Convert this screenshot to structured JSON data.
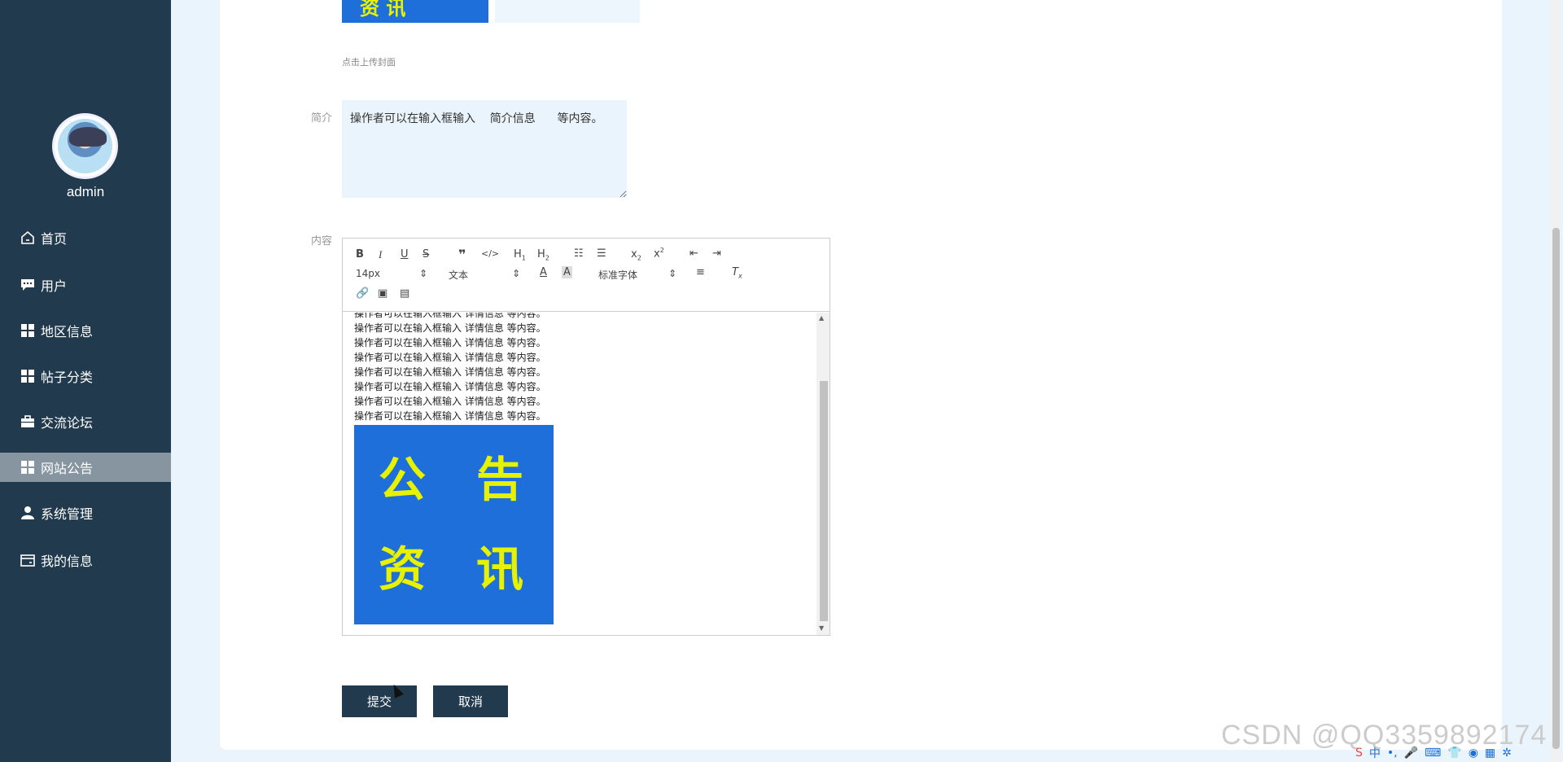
{
  "sidebar": {
    "username": "admin",
    "items": [
      {
        "label": "首页",
        "icon": "home-icon"
      },
      {
        "label": "用户",
        "icon": "chat-icon"
      },
      {
        "label": "地区信息",
        "icon": "grid-icon"
      },
      {
        "label": "帖子分类",
        "icon": "grid-icon"
      },
      {
        "label": "交流论坛",
        "icon": "briefcase-icon"
      },
      {
        "label": "网站公告",
        "icon": "grid-icon",
        "active": true
      },
      {
        "label": "系统管理",
        "icon": "user-icon"
      },
      {
        "label": "我的信息",
        "icon": "card-icon"
      }
    ]
  },
  "form": {
    "cover_image_text": "资 讯",
    "upload_hint": "点击上传封面",
    "summary_label": "简介",
    "summary_value": "操作者可以在输入框输入    简介信息      等内容。",
    "content_label": "内容",
    "editor": {
      "font_size": "14px",
      "paragraph": "文本",
      "font_family": "标准字体",
      "lines": [
        "操作者可以在输入框输入  详情信息  等内容。",
        "操作者可以在输入框输入  详情信息  等内容。",
        "操作者可以在输入框输入  详情信息  等内容。",
        "操作者可以在输入框输入  详情信息  等内容。",
        "操作者可以在输入框输入  详情信息  等内容。",
        "操作者可以在输入框输入  详情信息  等内容。",
        "操作者可以在输入框输入  详情信息  等内容。",
        "操作者可以在输入框输入  详情信息  等内容。"
      ],
      "image_chars": [
        "公",
        "告",
        "资",
        "讯"
      ]
    },
    "submit_label": "提交",
    "cancel_label": "取消"
  },
  "watermark": "CSDN @QQ3359892174",
  "tray": {
    "ime": "中"
  }
}
